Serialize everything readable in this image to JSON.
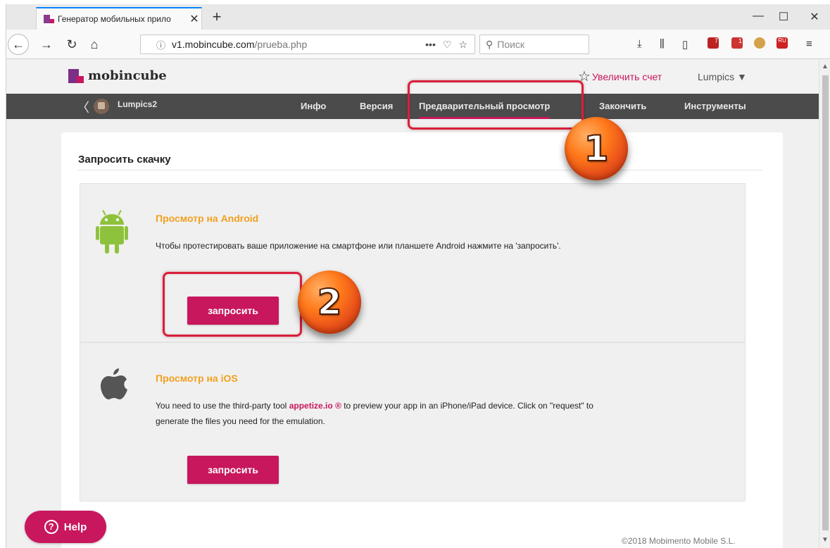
{
  "browser": {
    "tab_title": "Генератор мобильных прило",
    "tab_close": "✕",
    "new_tab": "+",
    "win_min": "—",
    "win_max": "☐",
    "win_close": "✕",
    "url_host": "v1.mobincube.com",
    "url_path": "/prueba.php",
    "url_more": "•••",
    "search_placeholder": "Поиск",
    "ext_badge_ug": "7",
    "ext_badge_1": "1",
    "ext_badge_ru": "RU"
  },
  "site": {
    "logo_text": "mobincube",
    "upgrade_label": "Увеличить счет",
    "user_label": "Lumpics ▼"
  },
  "nav": {
    "back": "〈",
    "project": "Lumpics2",
    "items": [
      "Инфо",
      "Версия",
      "Предварительный просмотр",
      "Закончить",
      "Инструменты"
    ]
  },
  "card": {
    "title": "Запросить скачку",
    "android": {
      "title": "Просмотр на Android",
      "text": "Чтобы протестировать ваше приложение на смартфоне или планшете Android нажмите на 'запросить'.",
      "button": "запросить"
    },
    "ios": {
      "title": "Просмотр на iOS",
      "text_before": "You need to use the third-party tool ",
      "link": "appetize.io ®",
      "text_after": " to preview your app in an iPhone/iPad device. Click on \"request\" to generate the files you need for the emulation.",
      "button": "запросить"
    }
  },
  "help_label": "Help",
  "help_mark": "?",
  "footer": "©2018 Mobimento Mobile S.L.",
  "annotations": {
    "badge1": "1",
    "badge2": "2"
  },
  "colors": {
    "brand": "#c8175d",
    "accent_orange": "#f2a01e",
    "nav_bg": "#4b4b4b",
    "android_green": "#8fc23c"
  }
}
